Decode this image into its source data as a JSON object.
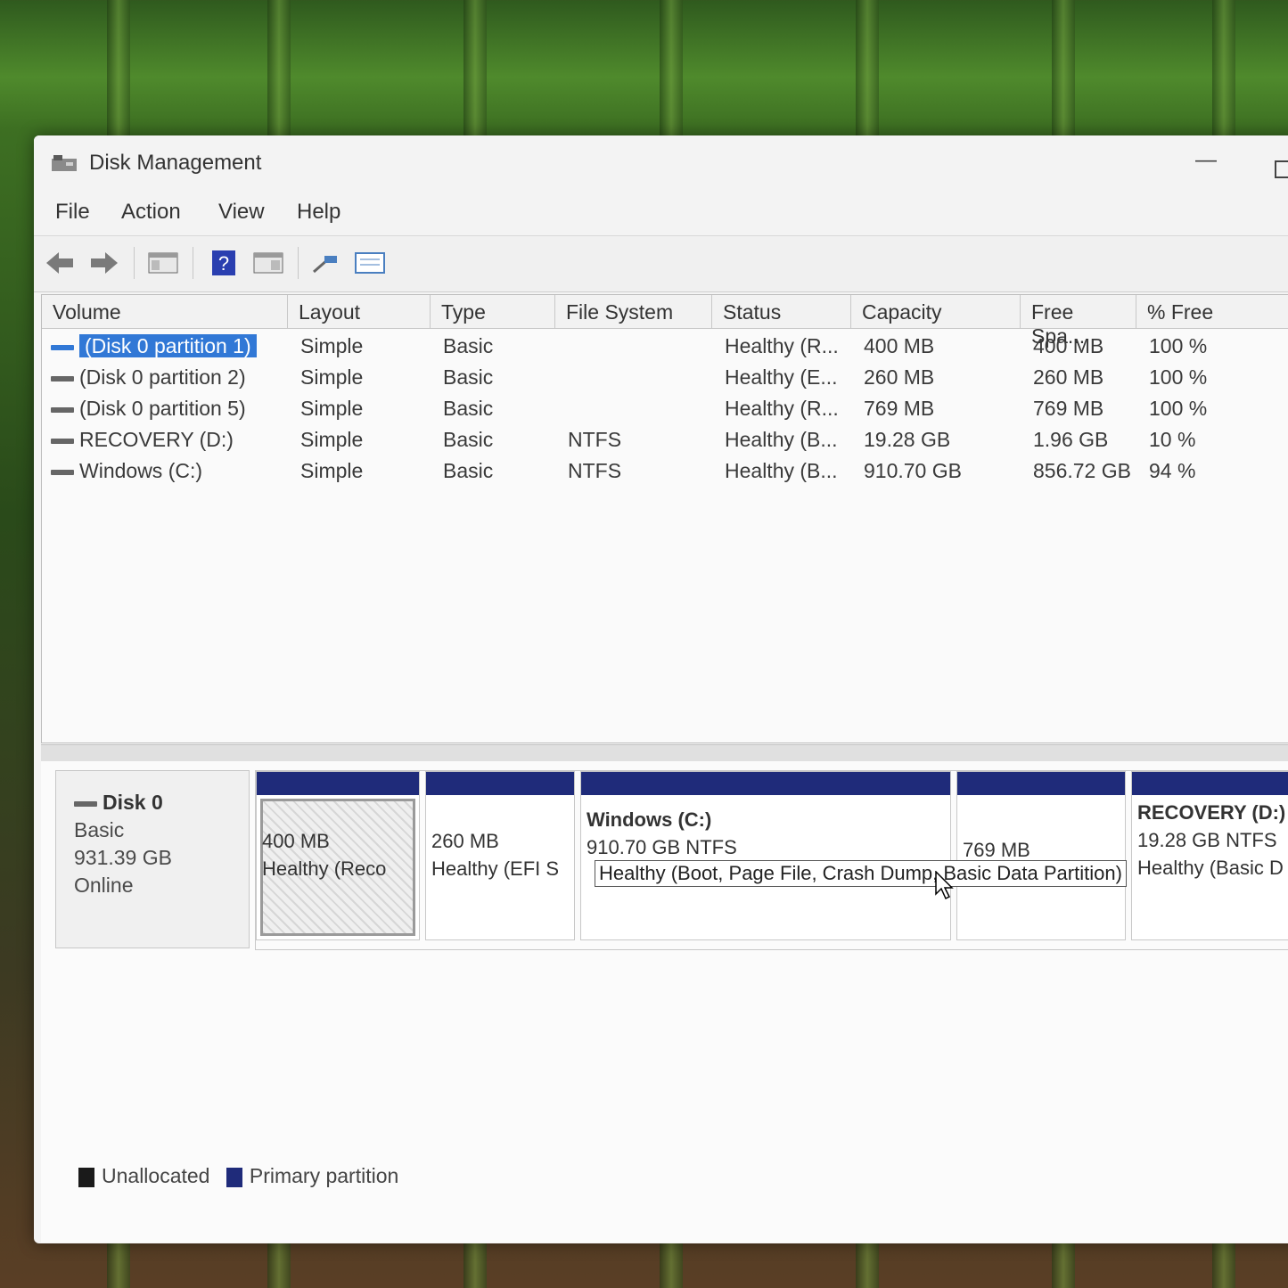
{
  "window": {
    "title": "Disk Management"
  },
  "menu": {
    "items": [
      "File",
      "Action",
      "View",
      "Help"
    ]
  },
  "toolbar": {
    "icons": [
      "back-arrow-icon",
      "forward-arrow-icon",
      "show-hide-console-tree-icon",
      "help-icon",
      "properties-icon",
      "connect-icon",
      "settings-icon"
    ]
  },
  "volume_list": {
    "columns": [
      "Volume",
      "Layout",
      "Type",
      "File System",
      "Status",
      "Capacity",
      "Free Spa...",
      "% Free"
    ],
    "rows": [
      {
        "volume": "(Disk 0 partition 1)",
        "layout": "Simple",
        "type": "Basic",
        "fs": "",
        "status": "Healthy (R...",
        "capacity": "400 MB",
        "free": "400 MB",
        "pct": "100 %"
      },
      {
        "volume": "(Disk 0 partition 2)",
        "layout": "Simple",
        "type": "Basic",
        "fs": "",
        "status": "Healthy (E...",
        "capacity": "260 MB",
        "free": "260 MB",
        "pct": "100 %"
      },
      {
        "volume": "(Disk 0 partition 5)",
        "layout": "Simple",
        "type": "Basic",
        "fs": "",
        "status": "Healthy (R...",
        "capacity": "769 MB",
        "free": "769 MB",
        "pct": "100 %"
      },
      {
        "volume": "RECOVERY (D:)",
        "layout": "Simple",
        "type": "Basic",
        "fs": "NTFS",
        "status": "Healthy (B...",
        "capacity": "19.28 GB",
        "free": "1.96 GB",
        "pct": "10 %"
      },
      {
        "volume": "Windows (C:)",
        "layout": "Simple",
        "type": "Basic",
        "fs": "NTFS",
        "status": "Healthy (B...",
        "capacity": "910.70 GB",
        "free": "856.72 GB",
        "pct": "94 %"
      }
    ]
  },
  "disk": {
    "name": "Disk 0",
    "type": "Basic",
    "size": "931.39 GB",
    "state": "Online",
    "partitions": [
      {
        "size": "400 MB",
        "status": "Healthy (Reco"
      },
      {
        "size": "260 MB",
        "status": "Healthy (EFI S"
      },
      {
        "name": "Windows  (C:)",
        "size": "910.70 GB NTFS"
      },
      {
        "size": "769 MB"
      },
      {
        "name": "RECOVERY  (D:)",
        "size": "19.28 GB NTFS",
        "status": "Healthy (Basic D"
      }
    ]
  },
  "tooltip": "Healthy (Boot, Page File, Crash Dump, Basic Data Partition)",
  "legend": {
    "items": [
      {
        "label": "Unallocated",
        "color": "#1a1a1a"
      },
      {
        "label": "Primary partition",
        "color": "#1f2b7a"
      }
    ]
  }
}
